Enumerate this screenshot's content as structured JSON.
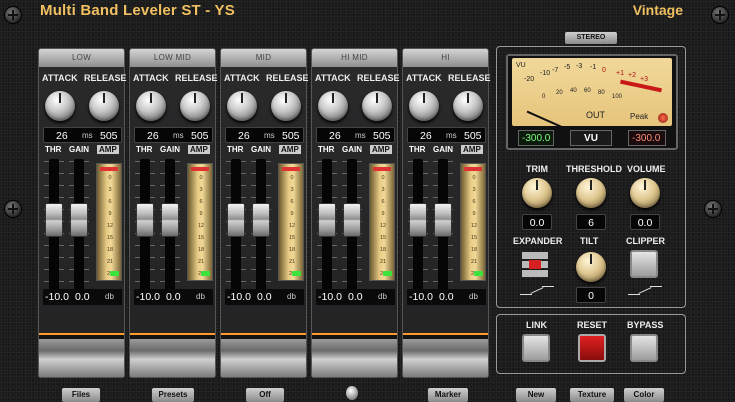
{
  "header": {
    "title": "Multi Band Leveler ST - YS",
    "style": "Vintage",
    "stereo": "STEREO"
  },
  "strip_labels": {
    "attack": "ATTACK",
    "release": "RELEASE",
    "thr": "THR",
    "gain": "GAIN",
    "amp": "AMP",
    "ms": "ms",
    "db": "db"
  },
  "bands": [
    {
      "name": "LOW",
      "attack": "26",
      "release": "505",
      "thr": "-10.0",
      "gain": "0.0"
    },
    {
      "name": "LOW MID",
      "attack": "26",
      "release": "505",
      "thr": "-10.0",
      "gain": "0.0"
    },
    {
      "name": "MID",
      "attack": "26",
      "release": "505",
      "thr": "-10.0",
      "gain": "0.0"
    },
    {
      "name": "HI MID",
      "attack": "26",
      "release": "505",
      "thr": "-10.0",
      "gain": "0.0"
    },
    {
      "name": "HI",
      "attack": "26",
      "release": "505",
      "thr": "-10.0",
      "gain": "0.0"
    }
  ],
  "amp_scale": [
    "0",
    "3",
    "6",
    "9",
    "12",
    "15",
    "18",
    "21",
    "24"
  ],
  "vu": {
    "scale_top": [
      "-20",
      "-10",
      "-7",
      "-5",
      "-3",
      "-1",
      "0",
      "+1",
      "+2",
      "+3"
    ],
    "scale_bottom": [
      "0",
      "20",
      "40",
      "60",
      "80",
      "100"
    ],
    "label": "VU",
    "left": "-300.0",
    "mode": "VU",
    "right": "-300.0",
    "out": "OUT",
    "peak": "Peak"
  },
  "master": {
    "trim_label": "TRIM",
    "trim": "0.0",
    "threshold_label": "THRESHOLD",
    "threshold": "6",
    "volume_label": "VOLUME",
    "volume": "0.0",
    "expander_label": "EXPANDER",
    "tilt_label": "TILT",
    "tilt": "0",
    "clipper_label": "CLIPPER"
  },
  "controls": {
    "link": "LINK",
    "reset": "RESET",
    "bypass": "BYPASS"
  },
  "bottom_bar": {
    "files": "Files",
    "presets": "Presets",
    "off": "Off",
    "marker": "Marker",
    "new": "New",
    "texture": "Texture",
    "color": "Color"
  },
  "colors": {
    "title": "#f0c060",
    "reset": "#c81818",
    "vu_face": "#ebcb85",
    "led": "#3be33b"
  }
}
